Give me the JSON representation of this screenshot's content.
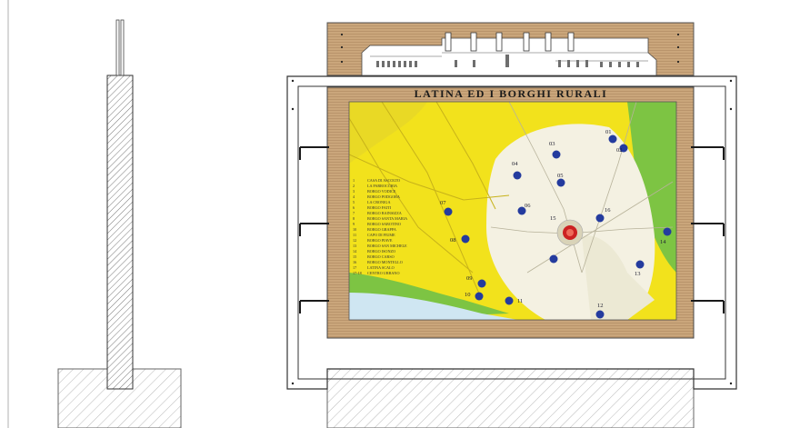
{
  "drawing": {
    "panel_title": "LATINA ED I BORGHI RURALI",
    "colors": {
      "wood": "#c9a57a",
      "wood_grain": "#a57d52",
      "map_yellow": "#f2e21c",
      "map_green": "#7dc443",
      "map_white": "#f4f1e2",
      "sea": "#cfe6f2",
      "marker": "#243b9e",
      "urban_center": "#cc2222",
      "hatch": "#888888",
      "line": "#333333"
    }
  },
  "legend": {
    "items": [
      {
        "num": "1",
        "text": "CASA DI ASCOLTO"
      },
      {
        "num": "2",
        "text": "LA PARROCCHIA"
      },
      {
        "num": "3",
        "text": "BORGO VODICE"
      },
      {
        "num": "4",
        "text": "BORGO PODGORA"
      },
      {
        "num": "5",
        "text": "LA CRONIGA"
      },
      {
        "num": "6",
        "text": "BORGO FAITI"
      },
      {
        "num": "7",
        "text": "BORGO BAINSIZZA"
      },
      {
        "num": "8",
        "text": "BORGO SANTA MARIA"
      },
      {
        "num": "9",
        "text": "BORGO SABOTINO"
      },
      {
        "num": "10",
        "text": "BORGO GRAPPA"
      },
      {
        "num": "11",
        "text": "CAPO DI FIUME"
      },
      {
        "num": "12",
        "text": "BORGO PIAVE"
      },
      {
        "num": "13",
        "text": "BORGO SAN MICHELE"
      },
      {
        "num": "14",
        "text": "BORGO ISONZO"
      },
      {
        "num": "15",
        "text": "BORGO CARSO"
      },
      {
        "num": "16",
        "text": "BORGO MONTELLO"
      },
      {
        "num": "17",
        "text": "LATINA SCALO"
      },
      {
        "num": "17-18",
        "text": "CENTRO URBANO"
      }
    ]
  },
  "markers": [
    {
      "label": "01"
    },
    {
      "label": "02"
    },
    {
      "label": "03"
    },
    {
      "label": "04"
    },
    {
      "label": "05"
    },
    {
      "label": "06"
    },
    {
      "label": "07"
    },
    {
      "label": "08"
    },
    {
      "label": "09"
    },
    {
      "label": "10"
    },
    {
      "label": "11"
    },
    {
      "label": "12"
    },
    {
      "label": "13"
    },
    {
      "label": "14"
    },
    {
      "label": "15"
    },
    {
      "label": "16"
    }
  ]
}
